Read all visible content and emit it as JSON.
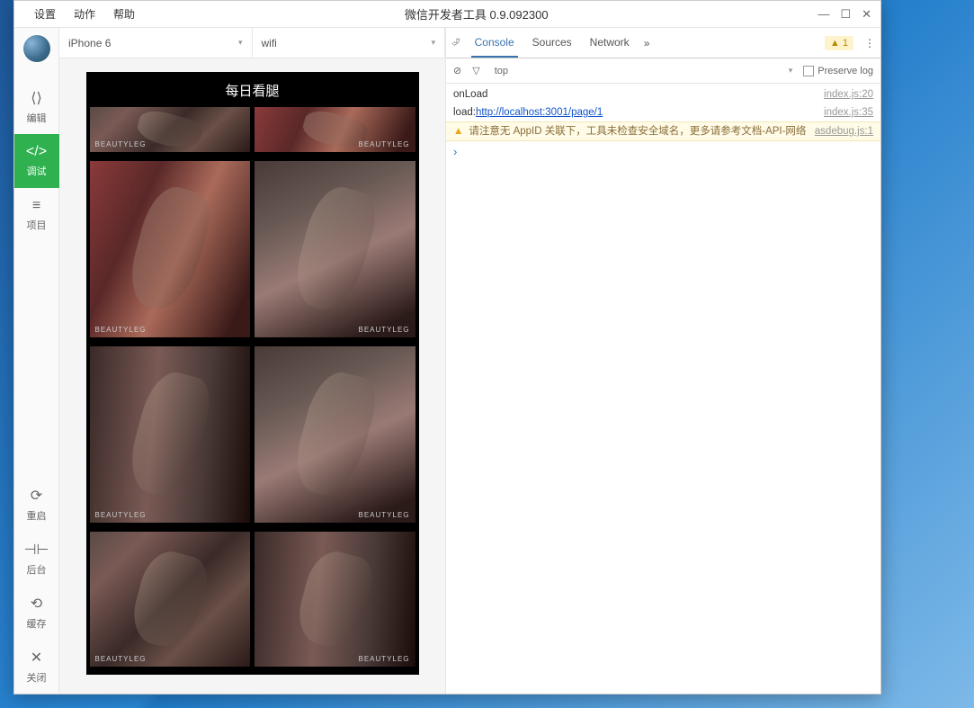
{
  "menu": {
    "settings": "设置",
    "actions": "动作",
    "help": "帮助"
  },
  "window_title": "微信开发者工具 0.9.092300",
  "sidebar": [
    {
      "icon": "⟨⟩",
      "label": "编辑"
    },
    {
      "icon": "</>",
      "label": "调试"
    },
    {
      "icon": "≡",
      "label": "项目"
    },
    {
      "icon": "⟳",
      "label": "重启"
    },
    {
      "icon": "⊣⊢",
      "label": "后台"
    },
    {
      "icon": "⟲",
      "label": "缓存"
    },
    {
      "icon": "✕",
      "label": "关闭"
    }
  ],
  "toolbar": {
    "device": "iPhone 6",
    "network": "wifi"
  },
  "app_title": "每日看腿",
  "thumb_mark": "BEAUTYLEG",
  "dev": {
    "tabs": {
      "console": "Console",
      "sources": "Sources",
      "network": "Network"
    },
    "warn_count": "1",
    "filter": {
      "top": "top",
      "preserve": "Preserve log"
    }
  },
  "logs": [
    {
      "type": "log",
      "msg": "onLoad",
      "src": "index.js:20"
    },
    {
      "type": "log",
      "prefix": "load:",
      "link": "http://localhost:3001/page/1",
      "src": "index.js:35"
    },
    {
      "type": "warn",
      "msg": "请注意无 AppID 关联下，工具未检查安全域名，更多请参考文档-API-网络",
      "src": "asdebug.js:1"
    }
  ],
  "prompt": "›"
}
